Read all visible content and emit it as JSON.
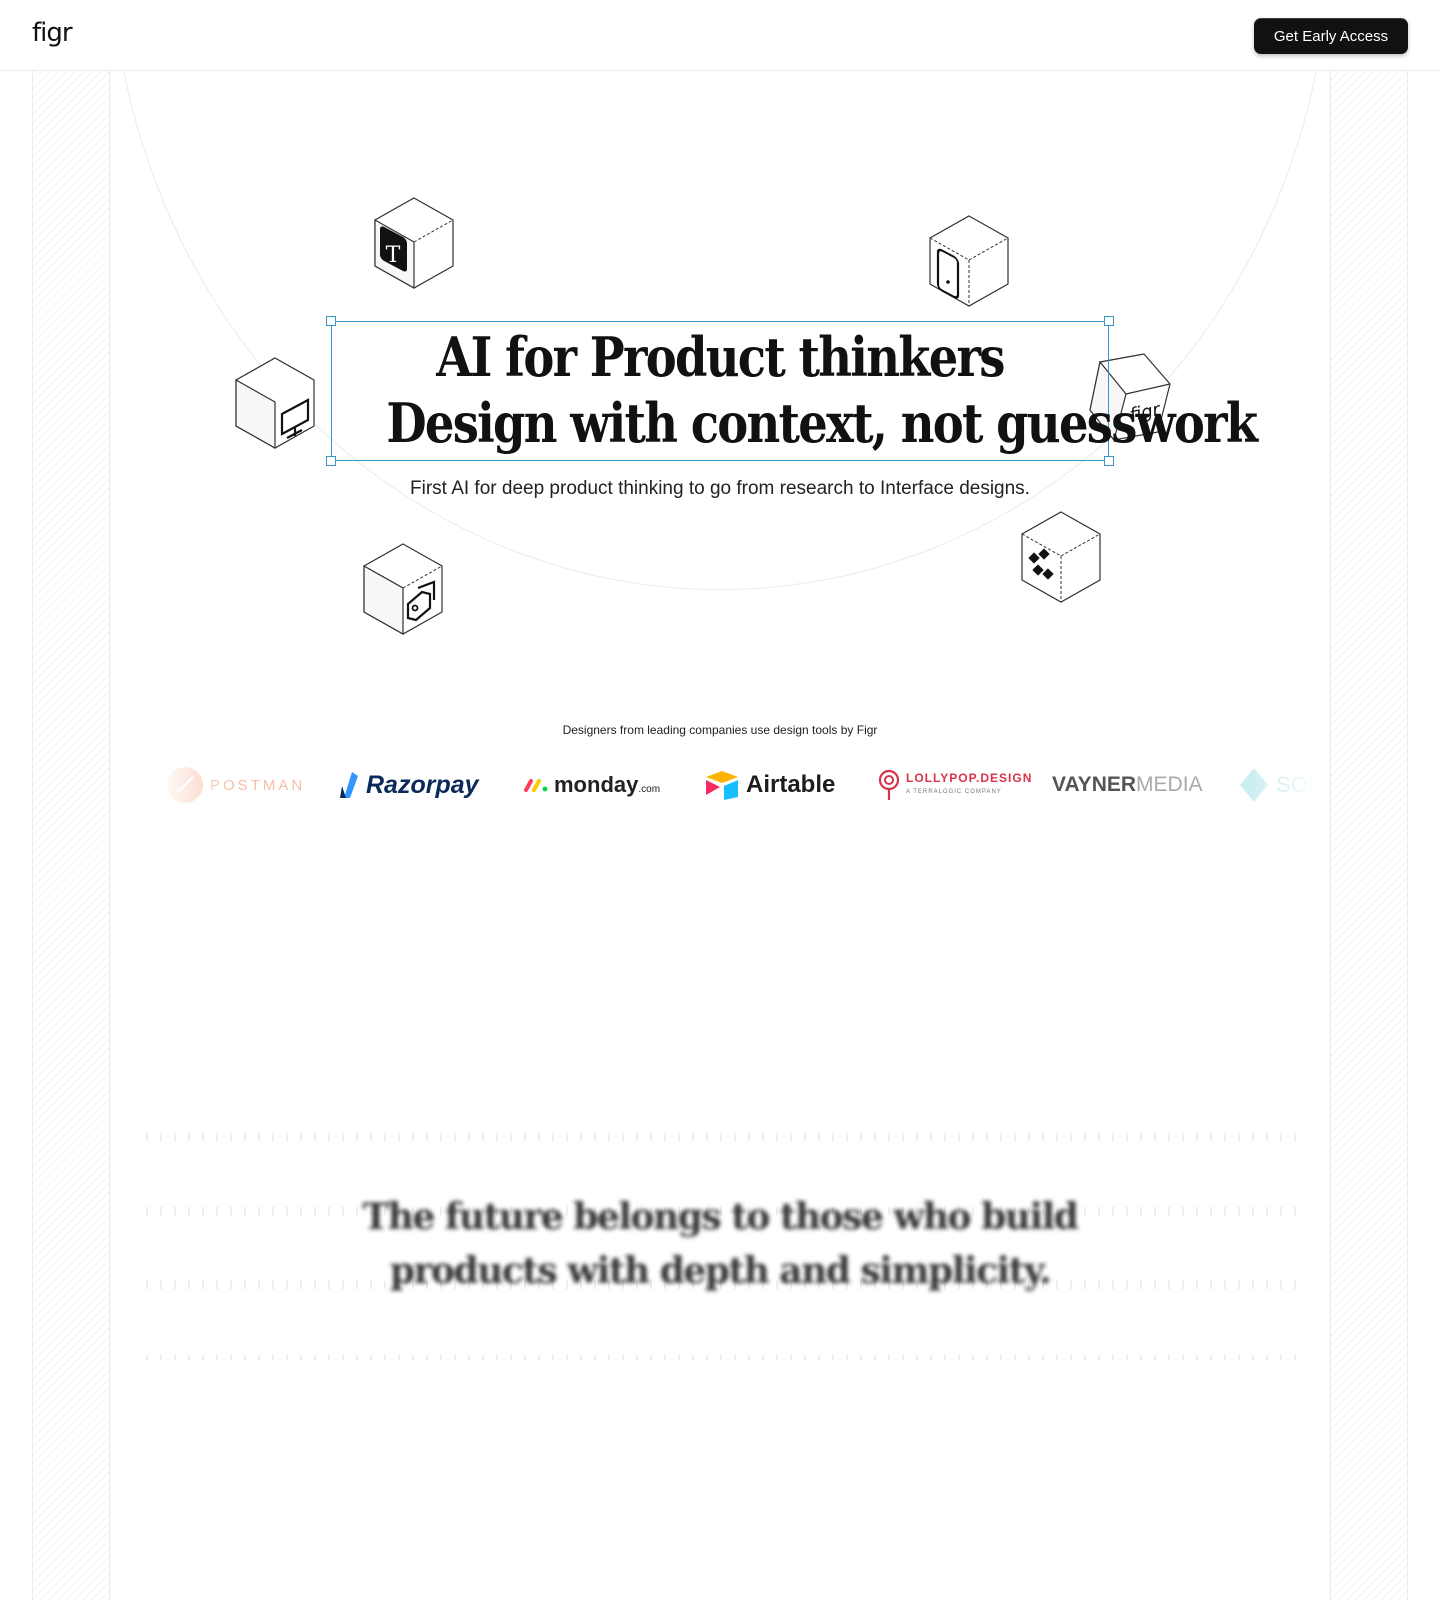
{
  "header": {
    "logo": "figr",
    "cta_label": "Get Early Access"
  },
  "hero": {
    "title_line_1": "AI for Product thinkers",
    "title_line_2": "Design with context, not guesswork",
    "subtitle": "First AI for deep product thinking to go from research to Interface designs.",
    "accent_color": "#3a95c9"
  },
  "cubes": [
    {
      "icon": "text-tool-icon",
      "label": "T"
    },
    {
      "icon": "mobile-device-icon"
    },
    {
      "icon": "desktop-monitor-icon"
    },
    {
      "icon": "figr-logo-icon",
      "label": "figr"
    },
    {
      "icon": "tag-icon"
    },
    {
      "icon": "grid-diamonds-icon"
    }
  ],
  "trusted": {
    "caption": "Designers from leading companies use design tools by Figr",
    "brands": {
      "postman": "POSTMAN",
      "razorpay": "Razorpay",
      "monday": "monday",
      "monday_suffix": ".com",
      "airtable": "Airtable",
      "lollypop": "LOLLYPOP.DESIGN",
      "lollypop_sub": "A TERRALOGIC COMPANY",
      "vayner_bold": "VAYNER",
      "vayner_light": "MEDIA",
      "soft": "SOF"
    }
  },
  "quote": {
    "line_1": "The future belongs to those who build",
    "line_2": "products with depth and simplicity."
  }
}
